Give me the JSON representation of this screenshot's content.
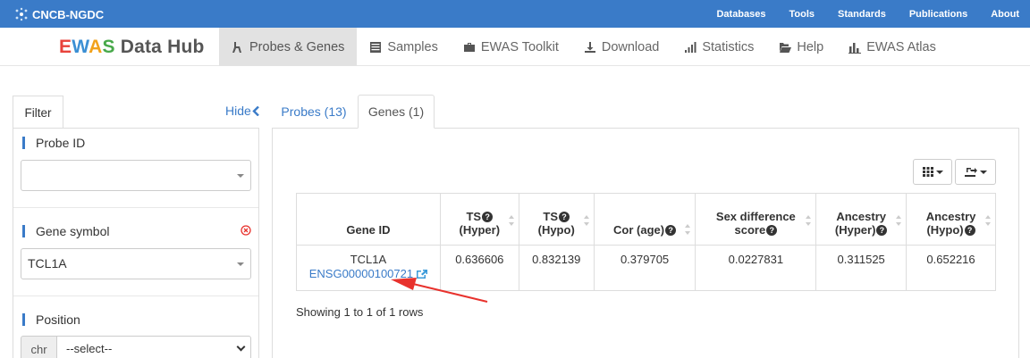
{
  "topbar": {
    "brand": "CNCB-NGDC",
    "links": [
      "Databases",
      "Tools",
      "Standards",
      "Publications",
      "About"
    ]
  },
  "app": {
    "title_parts": [
      "E",
      "W",
      "A",
      "S",
      " Data Hub"
    ]
  },
  "main_menu": [
    {
      "label": "Probes & Genes",
      "icon": "branch-icon",
      "active": true
    },
    {
      "label": "Samples",
      "icon": "list-icon",
      "active": false
    },
    {
      "label": "EWAS Toolkit",
      "icon": "briefcase-icon",
      "active": false
    },
    {
      "label": "Download",
      "icon": "download-icon",
      "active": false
    },
    {
      "label": "Statistics",
      "icon": "signal-icon",
      "active": false
    },
    {
      "label": "Help",
      "icon": "folder-open-icon",
      "active": false
    },
    {
      "label": "EWAS Atlas",
      "icon": "bar-chart-icon",
      "active": false
    }
  ],
  "sidebar": {
    "tab_label": "Filter",
    "hide_label": "Hide",
    "probe_id": {
      "label": "Probe ID",
      "value": ""
    },
    "gene_symbol": {
      "label": "Gene symbol",
      "value": "TCL1A"
    },
    "position": {
      "label": "Position",
      "chr_label": "chr",
      "select_value": "--select--"
    }
  },
  "tabs": {
    "probes": "Probes (13)",
    "genes": "Genes (1)"
  },
  "table": {
    "headers": {
      "gene_id": "Gene ID",
      "ts_hyper": [
        "TS",
        "(Hyper)"
      ],
      "ts_hypo": [
        "TS",
        "(Hypo)"
      ],
      "cor_age": "Cor (age)",
      "sex_diff": [
        "Sex difference",
        "score"
      ],
      "anc_hyper": [
        "Ancestry",
        "(Hyper)"
      ],
      "anc_hypo": [
        "Ancestry",
        "(Hypo)"
      ]
    },
    "rows": [
      {
        "gene_symbol": "TCL1A",
        "ensembl_id": "ENSG00000100721",
        "ts_hyper": "0.636606",
        "ts_hypo": "0.832139",
        "cor_age": "0.379705",
        "sex_diff": "0.0227831",
        "anc_hyper": "0.311525",
        "anc_hypo": "0.652216"
      }
    ]
  },
  "pagination": {
    "summary": "Showing 1 to 1 of 1 rows"
  },
  "colors": {
    "primary": "#3a7bc8",
    "annotation_arrow": "#e8322d"
  }
}
